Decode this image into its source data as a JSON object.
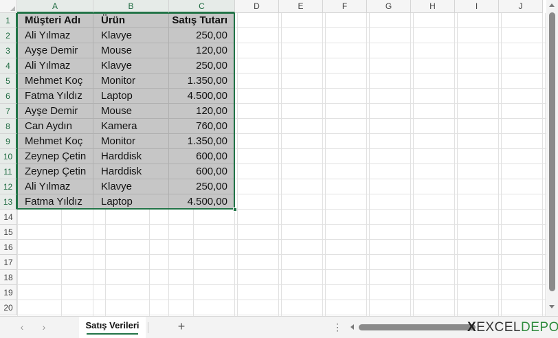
{
  "columns": [
    "A",
    "B",
    "C",
    "D",
    "E",
    "F",
    "G",
    "H",
    "I",
    "J"
  ],
  "rows": [
    "1",
    "2",
    "3",
    "4",
    "5",
    "6",
    "7",
    "8",
    "9",
    "10",
    "11",
    "12",
    "13",
    "14",
    "15",
    "16",
    "17",
    "18",
    "19",
    "20"
  ],
  "table": {
    "headers": [
      "Müşteri Adı",
      "Ürün",
      "Satış Tutarı"
    ],
    "rows": [
      [
        "Ali Yılmaz",
        "Klavye",
        "250,00"
      ],
      [
        "Ayşe Demir",
        "Mouse",
        "120,00"
      ],
      [
        "Ali Yılmaz",
        "Klavye",
        "250,00"
      ],
      [
        "Mehmet Koç",
        "Monitor",
        "1.350,00"
      ],
      [
        "Fatma Yıldız",
        "Laptop",
        "4.500,00"
      ],
      [
        "Ayşe Demir",
        "Mouse",
        "120,00"
      ],
      [
        "Can Aydın",
        "Kamera",
        "760,00"
      ],
      [
        "Mehmet Koç",
        "Monitor",
        "1.350,00"
      ],
      [
        "Zeynep Çetin",
        "Harddisk",
        "600,00"
      ],
      [
        "Zeynep Çetin",
        "Harddisk",
        "600,00"
      ],
      [
        "Ali Yılmaz",
        "Klavye",
        "250,00"
      ],
      [
        "Fatma Yıldız",
        "Laptop",
        "4.500,00"
      ]
    ]
  },
  "selection": {
    "range": "A1:C13"
  },
  "tabbar": {
    "prev_icon": "‹",
    "next_icon": "›",
    "active_sheet": "Satış Verileri",
    "add_icon": "+",
    "more_icon": "⋮"
  },
  "logo": {
    "x": "X",
    "excel": "EXCEL",
    "depo": "DEPO"
  },
  "colors": {
    "accent": "#217346",
    "selection_fill": "#c6c6c6",
    "header_bg": "#f5f5f5",
    "gridline": "#e1e1e1",
    "logo_green": "#2e8b3d"
  }
}
